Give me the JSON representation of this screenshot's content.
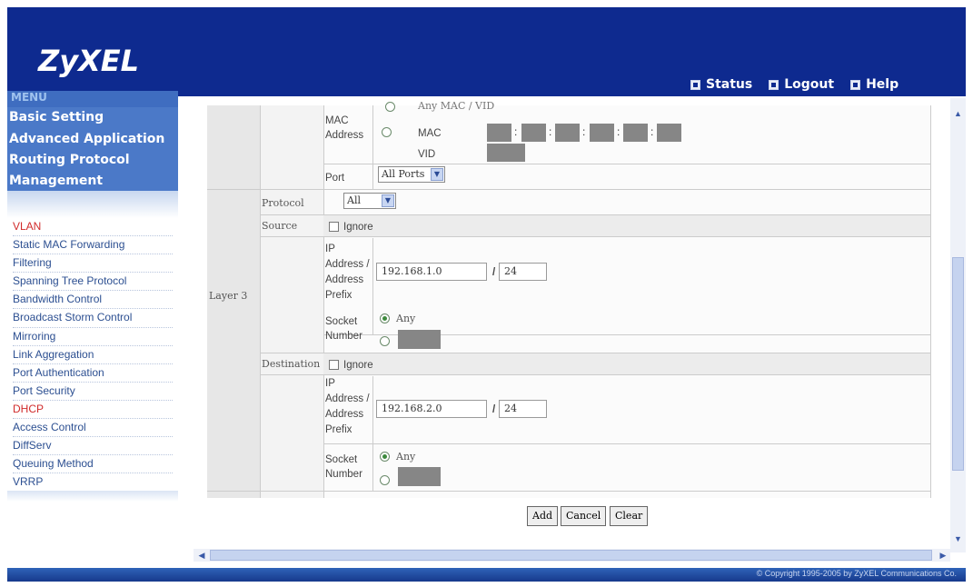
{
  "header": {
    "logo": "ZyXEL",
    "links": [
      "Status",
      "Logout",
      "Help"
    ]
  },
  "menu": {
    "title": "MENU",
    "items": [
      "Basic Setting",
      "Advanced Application",
      "Routing Protocol",
      "Management"
    ],
    "sub_items": [
      "VLAN",
      "Static MAC Forwarding",
      "Filtering",
      "Spanning Tree Protocol",
      "Bandwidth Control",
      "Broadcast Storm Control",
      "Mirroring",
      "Link Aggregation",
      "Port Authentication",
      "Port Security",
      "DHCP",
      "Access Control",
      "DiffServ",
      "Queuing Method",
      "VRRP"
    ]
  },
  "form": {
    "mac": {
      "label": "MAC Address",
      "any_option": "Any MAC / VID",
      "mac_label": "MAC",
      "vid_label": "VID"
    },
    "port": {
      "label": "Port",
      "value": "All Ports"
    },
    "layer3": {
      "label": "Layer 3",
      "protocol_label": "Protocol",
      "protocol_value": "All"
    },
    "source": {
      "label": "Source",
      "ignore_label": "Ignore",
      "ip_label": "IP Address / Address Prefix",
      "ip_value": "192.168.1.0",
      "prefix_value": "24",
      "socket_label": "Socket Number",
      "any_label": "Any"
    },
    "destination": {
      "label": "Destination",
      "ignore_label": "Ignore",
      "ip_label": "IP Address / Address Prefix",
      "ip_value": "192.168.2.0",
      "prefix_value": "24",
      "socket_label": "Socket Number",
      "any_label": "Any"
    },
    "slash": "/",
    "buttons": {
      "add": "Add",
      "cancel": "Cancel",
      "clear": "Clear"
    }
  },
  "footer": {
    "copyright": "© Copyright 1995-2005 by ZyXEL Communications Co."
  }
}
